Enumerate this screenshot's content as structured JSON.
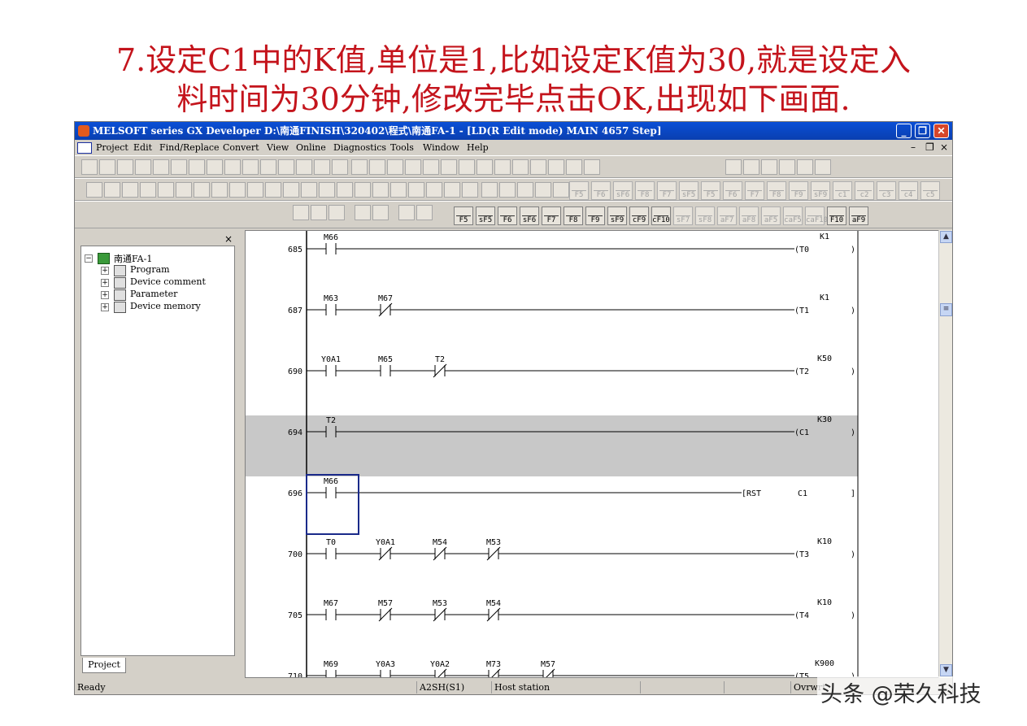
{
  "slide_title": {
    "line1": "7.设定C1中的K值,单位是1,比如设定K值为30,就是设定入",
    "line2": "料时间为30分钟,修改完毕点击OK,出现如下画面."
  },
  "window": {
    "title": "MELSOFT series GX Developer D:\\南通FINISH\\320402\\程式\\南通FA-1 - [LD(R Edit mode)    MAIN    4657 Step]",
    "minimize": "_",
    "restore": "❐",
    "close": "✕"
  },
  "menu": {
    "items": [
      "Project",
      "Edit",
      "Find/Replace",
      "Convert",
      "View",
      "Online",
      "Diagnostics",
      "Tools",
      "Window",
      "Help"
    ],
    "child_controls": [
      "–",
      "❐",
      "×"
    ]
  },
  "fkeys": [
    {
      "label": "F5",
      "enabled": true
    },
    {
      "label": "sF5",
      "enabled": true
    },
    {
      "label": "F6",
      "enabled": true
    },
    {
      "label": "sF6",
      "enabled": true
    },
    {
      "label": "F7",
      "enabled": true
    },
    {
      "label": "F8",
      "enabled": true
    },
    {
      "label": "F9",
      "enabled": true
    },
    {
      "label": "sF9",
      "enabled": true
    },
    {
      "label": "cF9",
      "enabled": true
    },
    {
      "label": "cF10",
      "enabled": true
    },
    {
      "label": "sF7",
      "enabled": false
    },
    {
      "label": "sF8",
      "enabled": false
    },
    {
      "label": "aF7",
      "enabled": false
    },
    {
      "label": "aF8",
      "enabled": false
    },
    {
      "label": "aF5",
      "enabled": false
    },
    {
      "label": "caF5",
      "enabled": false
    },
    {
      "label": "caF10",
      "enabled": false
    },
    {
      "label": "F10",
      "enabled": true
    },
    {
      "label": "aF9",
      "enabled": true
    }
  ],
  "fkeys_top": [
    "F5",
    "F6",
    "sF6",
    "F8",
    "F7",
    "sF5",
    "F5",
    "F6",
    "F7",
    "F8",
    "F9",
    "sF9",
    "c1",
    "c2",
    "c3",
    "c4",
    "c5"
  ],
  "project_panel": {
    "close": "×",
    "root": "南通FA-1",
    "nodes": [
      "Program",
      "Device comment",
      "Parameter",
      "Device memory"
    ],
    "tab": "Project"
  },
  "ladder": {
    "rungs": [
      {
        "step": "685",
        "contacts": [
          {
            "dev": "M66",
            "type": "NO"
          }
        ],
        "coil": "T0",
        "k": "K1",
        "selected": false
      },
      {
        "step": "687",
        "contacts": [
          {
            "dev": "M63",
            "type": "NO"
          },
          {
            "dev": "M67",
            "type": "NC"
          }
        ],
        "coil": "T1",
        "k": "K1",
        "selected": false
      },
      {
        "step": "690",
        "contacts": [
          {
            "dev": "Y0A1",
            "type": "NO"
          },
          {
            "dev": "M65",
            "type": "NO"
          },
          {
            "dev": "T2",
            "type": "NC"
          }
        ],
        "coil": "T2",
        "k": "K50",
        "selected": false
      },
      {
        "step": "694",
        "contacts": [
          {
            "dev": "T2",
            "type": "NO"
          }
        ],
        "coil": "C1",
        "k": "K30",
        "selected": true
      },
      {
        "step": "696",
        "contacts": [
          {
            "dev": "M66",
            "type": "NO"
          }
        ],
        "instr": "RST",
        "operand": "C1",
        "selected": false
      },
      {
        "step": "700",
        "contacts": [
          {
            "dev": "T0",
            "type": "NO"
          },
          {
            "dev": "Y0A1",
            "type": "NC"
          },
          {
            "dev": "M54",
            "type": "NC"
          },
          {
            "dev": "M53",
            "type": "NC"
          }
        ],
        "coil": "T3",
        "k": "K10",
        "selected": false
      },
      {
        "step": "705",
        "contacts": [
          {
            "dev": "M67",
            "type": "NO"
          },
          {
            "dev": "M57",
            "type": "NC"
          },
          {
            "dev": "M53",
            "type": "NC"
          },
          {
            "dev": "M54",
            "type": "NC"
          }
        ],
        "coil": "T4",
        "k": "K10",
        "selected": false
      },
      {
        "step": "710",
        "contacts": [
          {
            "dev": "M69",
            "type": "NO"
          },
          {
            "dev": "Y0A3",
            "type": "NO"
          },
          {
            "dev": "Y0A2",
            "type": "NC"
          },
          {
            "dev": "M73",
            "type": "NC"
          },
          {
            "dev": "M57",
            "type": "NC"
          }
        ],
        "coil": "T5",
        "k": "K900",
        "selected": false
      }
    ],
    "colors": {
      "selected_band": "#c8c8c8",
      "cursor": "#1a2a8a",
      "line": "#000000"
    }
  },
  "statusbar": {
    "ready": "Ready",
    "cpu": "A2SH(S1)",
    "station": "Host station",
    "mode": "Ovrwrt"
  },
  "watermark": "头条 @荣久科技"
}
